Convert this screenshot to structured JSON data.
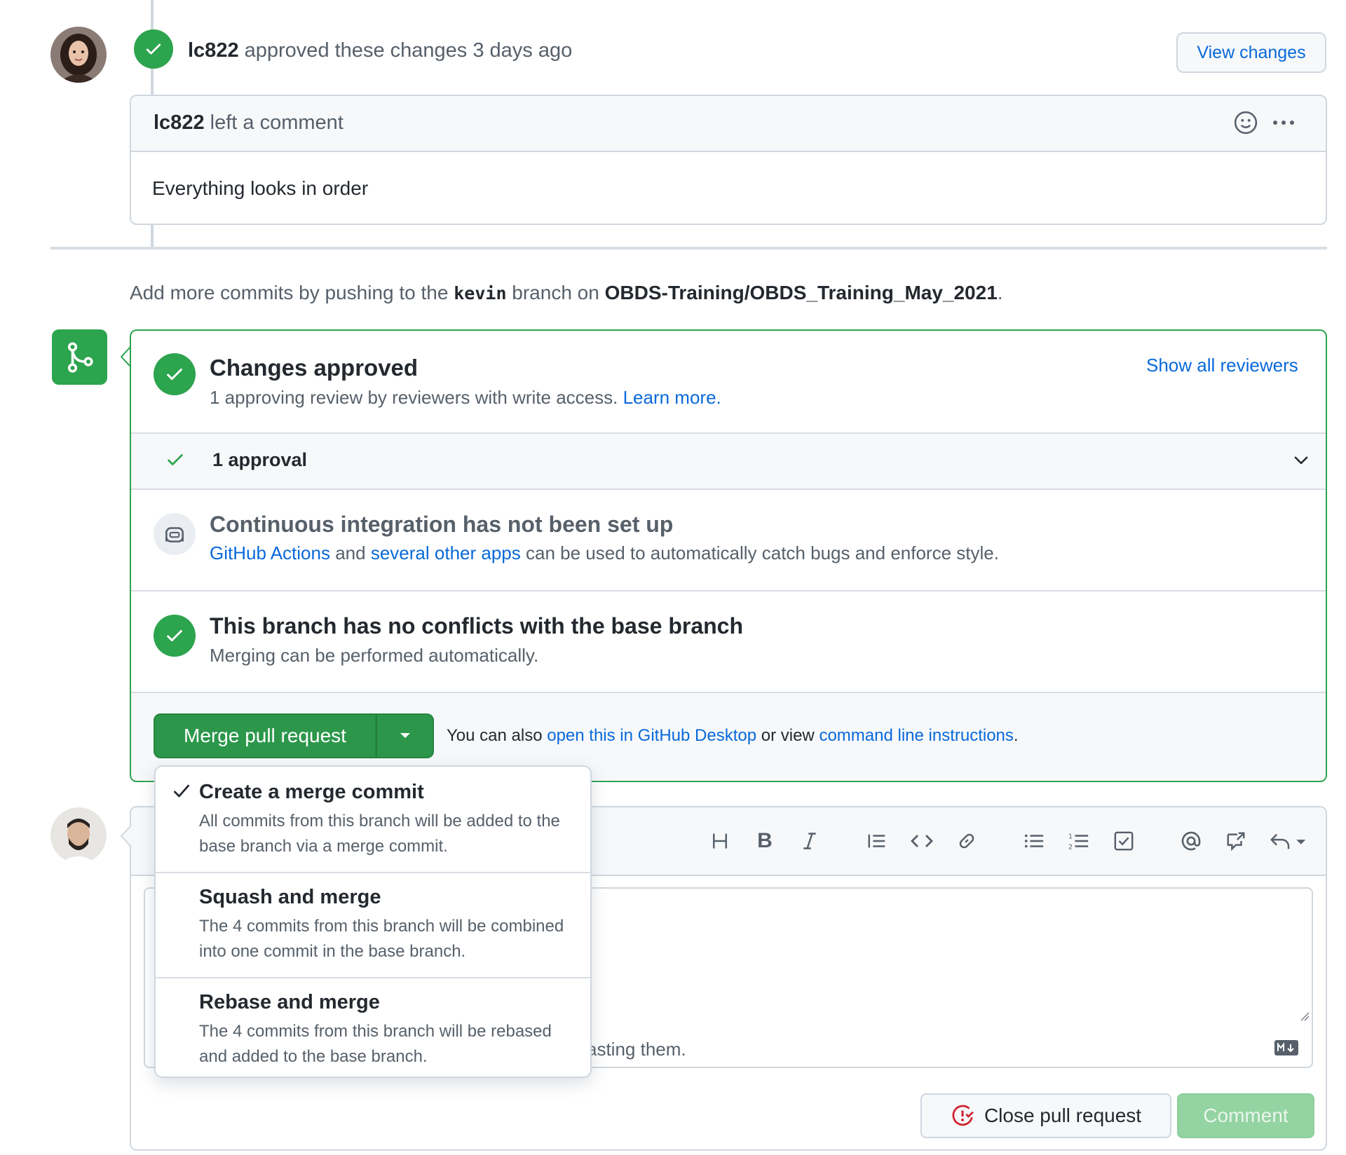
{
  "review": {
    "username": "lc822",
    "action_text": "approved these changes",
    "time": "3 days ago",
    "view_changes": "View changes",
    "comment_username": "lc822",
    "comment_action": "left a comment",
    "comment_body": "Everything looks in order"
  },
  "push_note": {
    "prefix": "Add more commits by pushing to the",
    "branch": "kevin",
    "middle": "branch on",
    "repo": "OBDS-Training/OBDS_Training_May_2021",
    "suffix": "."
  },
  "merge_box": {
    "changes_title": "Changes approved",
    "changes_desc": "1 approving review by reviewers with write access.",
    "learn_more": "Learn more.",
    "show_reviewers": "Show all reviewers",
    "approval_count": "1 approval",
    "ci_title": "Continuous integration has not been set up",
    "ci_link1": "GitHub Actions",
    "ci_and": "and",
    "ci_link2": "several other apps",
    "ci_rest": "can be used to automatically catch bugs and enforce style.",
    "conflict_title": "This branch has no conflicts with the base branch",
    "conflict_desc": "Merging can be performed automatically.",
    "merge_button": "Merge pull request",
    "also_prefix": "You can also",
    "also_link1": "open this in GitHub Desktop",
    "also_mid": "or view",
    "also_link2": "command line instructions",
    "also_suffix": "."
  },
  "merge_menu": {
    "items": [
      {
        "title": "Create a merge commit",
        "desc": "All commits from this branch will be added to the base branch via a merge commit.",
        "selected": true
      },
      {
        "title": "Squash and merge",
        "desc": "The 4 commits from this branch will be combined into one commit in the base branch.",
        "selected": false
      },
      {
        "title": "Rebase and merge",
        "desc": "The 4 commits from this branch will be rebased and added to the base branch.",
        "selected": false
      }
    ]
  },
  "comment_form": {
    "partial_hint": "asting them.",
    "close_button": "Close pull request",
    "comment_button": "Comment",
    "toolbar_icons": [
      "heading-icon",
      "bold-icon",
      "italic-icon",
      "quote-icon",
      "code-icon",
      "link-icon",
      "bullet-list-icon",
      "numbered-list-icon",
      "task-list-icon",
      "mention-icon",
      "cross-reference-icon",
      "reply-icon"
    ]
  },
  "colors": {
    "green": "#2da44e",
    "link_blue": "#0969da",
    "merge_button": "#2c974b",
    "comment_disabled": "#94d3a2",
    "close_icon_red": "#cf222e"
  }
}
